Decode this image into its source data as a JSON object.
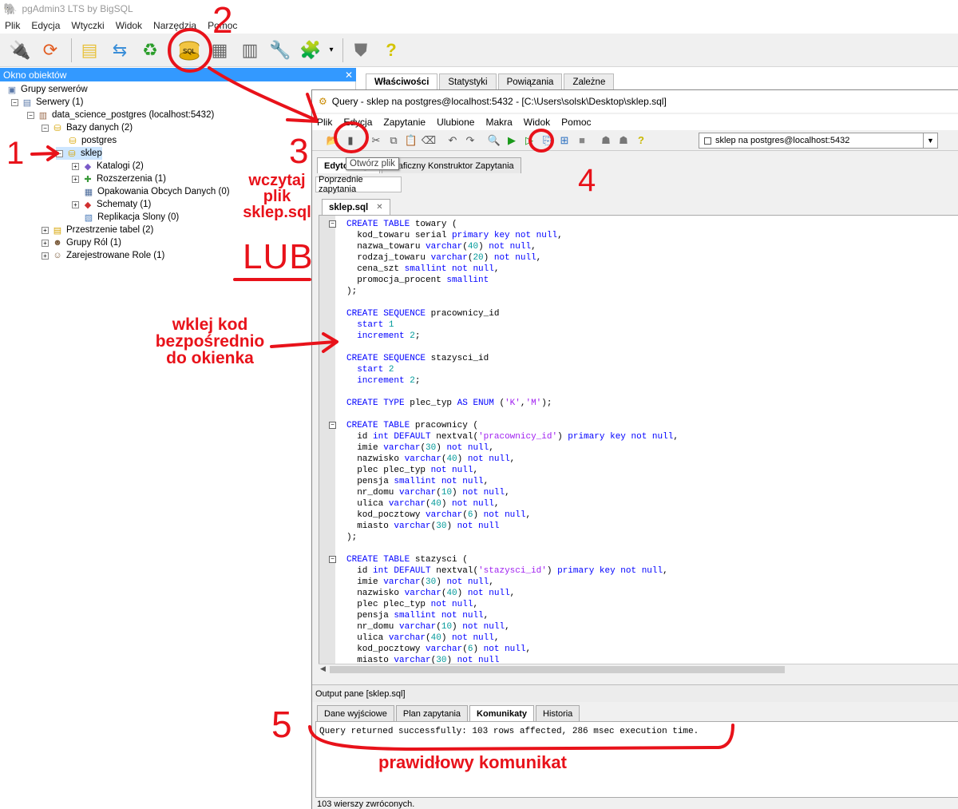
{
  "window": {
    "title": "pgAdmin3 LTS by BigSQL"
  },
  "menu": [
    "Plik",
    "Edycja",
    "Wtyczki",
    "Widok",
    "Narzędzia",
    "Pomoc"
  ],
  "toolbar": {
    "icons": [
      "plug-icon",
      "refresh-icon",
      "folders-icon",
      "transfer-icon",
      "recycle-icon",
      "sql-icon",
      "grid-icon",
      "filter-grid-icon",
      "wrench-icon",
      "plugin-icon",
      "dropdown-icon",
      "shield-icon",
      "help-icon"
    ]
  },
  "object_browser": {
    "title": "Okno obiektów",
    "close": "✕",
    "tree": [
      {
        "label": "Grupy serwerów",
        "icon": "server-group-icon",
        "level": 0,
        "toggle": ""
      },
      {
        "label": "Serwery (1)",
        "icon": "servers-icon",
        "level": 1,
        "toggle": "−"
      },
      {
        "label": "data_science_postgres (localhost:5432)",
        "icon": "server-icon",
        "level": 2,
        "toggle": "−"
      },
      {
        "label": "Bazy danych (2)",
        "icon": "databases-icon",
        "level": 3,
        "toggle": "−"
      },
      {
        "label": "postgres",
        "icon": "database-icon",
        "level": 4,
        "toggle": ""
      },
      {
        "label": "sklep",
        "icon": "database-icon",
        "level": 4,
        "toggle": "−"
      },
      {
        "label": "Katalogi (2)",
        "icon": "catalog-icon",
        "level": 5,
        "toggle": "+"
      },
      {
        "label": "Rozszerzenia (1)",
        "icon": "extension-icon",
        "level": 5,
        "toggle": "+"
      },
      {
        "label": "Opakowania Obcych Danych (0)",
        "icon": "fdw-icon",
        "level": 5,
        "toggle": ""
      },
      {
        "label": "Schematy (1)",
        "icon": "schema-icon",
        "level": 5,
        "toggle": "+"
      },
      {
        "label": "Replikacja Slony (0)",
        "icon": "slony-icon",
        "level": 5,
        "toggle": ""
      },
      {
        "label": "Przestrzenie tabel (2)",
        "icon": "tablespace-icon",
        "level": 3,
        "toggle": "+"
      },
      {
        "label": "Grupy Ról (1)",
        "icon": "group-roles-icon",
        "level": 3,
        "toggle": "+"
      },
      {
        "label": "Zarejestrowane Role (1)",
        "icon": "login-roles-icon",
        "level": 3,
        "toggle": "+"
      }
    ]
  },
  "properties_tabs": [
    "Właściwości",
    "Statystyki",
    "Powiązania",
    "Zależne"
  ],
  "query": {
    "title": "Query - sklep na postgres@localhost:5432 - [C:\\Users\\solsk\\Desktop\\sklep.sql]",
    "menu": [
      "Plik",
      "Edycja",
      "Zapytanie",
      "Ulubione",
      "Makra",
      "Widok",
      "Pomoc"
    ],
    "connection": "sklep na postgres@localhost:5432",
    "editor_tabs": [
      "Edytor SQL",
      "Graficzny Konstruktor Zapytania"
    ],
    "tooltip": "Otwórz plik",
    "previous_queries": "Poprzednie zapytania",
    "file_tab": "sklep.sql",
    "file_close": "✕",
    "output_title": "Output pane [sklep.sql]",
    "output_tabs": [
      "Dane wyjściowe",
      "Plan zapytania",
      "Komunikaty",
      "Historia"
    ],
    "message": "Query returned successfully: 103 rows affected, 286 msec execution time.",
    "status": "103 wierszy zwróconych."
  },
  "code_lines": [
    [
      [
        "CREATE TABLE",
        "kw"
      ],
      [
        " towary (",
        ""
      ]
    ],
    [
      [
        "  kod_towaru serial ",
        ""
      ],
      [
        "primary key not null",
        "kw"
      ],
      [
        ",",
        ""
      ]
    ],
    [
      [
        "  nazwa_towaru ",
        ""
      ],
      [
        "varchar",
        "kw"
      ],
      [
        "(",
        ""
      ],
      [
        "40",
        "nm"
      ],
      [
        ") ",
        ""
      ],
      [
        "not null",
        "kw"
      ],
      [
        ",",
        ""
      ]
    ],
    [
      [
        "  rodzaj_towaru ",
        ""
      ],
      [
        "varchar",
        "kw"
      ],
      [
        "(",
        ""
      ],
      [
        "20",
        "nm"
      ],
      [
        ") ",
        ""
      ],
      [
        "not null",
        "kw"
      ],
      [
        ",",
        ""
      ]
    ],
    [
      [
        "  cena_szt ",
        ""
      ],
      [
        "smallint not null",
        "kw"
      ],
      [
        ",",
        ""
      ]
    ],
    [
      [
        "  promocja_procent ",
        ""
      ],
      [
        "smallint",
        "kw"
      ]
    ],
    [
      [
        ");",
        ""
      ]
    ],
    [],
    [
      [
        "CREATE SEQUENCE",
        "kw"
      ],
      [
        " pracownicy_id",
        ""
      ]
    ],
    [
      [
        "  ",
        ""
      ],
      [
        "start",
        "kw"
      ],
      [
        " ",
        ""
      ],
      [
        "1",
        "nm"
      ]
    ],
    [
      [
        "  ",
        ""
      ],
      [
        "increment",
        "kw"
      ],
      [
        " ",
        ""
      ],
      [
        "2",
        "nm"
      ],
      [
        ";",
        ""
      ]
    ],
    [],
    [
      [
        "CREATE SEQUENCE",
        "kw"
      ],
      [
        " stazysci_id",
        ""
      ]
    ],
    [
      [
        "  ",
        ""
      ],
      [
        "start",
        "kw"
      ],
      [
        " ",
        ""
      ],
      [
        "2",
        "nm"
      ]
    ],
    [
      [
        "  ",
        ""
      ],
      [
        "increment",
        "kw"
      ],
      [
        " ",
        ""
      ],
      [
        "2",
        "nm"
      ],
      [
        ";",
        ""
      ]
    ],
    [],
    [
      [
        "CREATE TYPE",
        "kw"
      ],
      [
        " plec_typ ",
        ""
      ],
      [
        "AS ENUM",
        "kw"
      ],
      [
        " (",
        ""
      ],
      [
        "'K'",
        "st"
      ],
      [
        ",",
        ""
      ],
      [
        "'M'",
        "st"
      ],
      [
        ");",
        ""
      ]
    ],
    [],
    [
      [
        "CREATE TABLE",
        "kw"
      ],
      [
        " pracownicy (",
        ""
      ]
    ],
    [
      [
        "  id ",
        ""
      ],
      [
        "int DEFAULT",
        "kw"
      ],
      [
        " nextval(",
        ""
      ],
      [
        "'pracownicy_id'",
        "st"
      ],
      [
        ") ",
        ""
      ],
      [
        "primary key not null",
        "kw"
      ],
      [
        ",",
        ""
      ]
    ],
    [
      [
        "  imie ",
        ""
      ],
      [
        "varchar",
        "kw"
      ],
      [
        "(",
        ""
      ],
      [
        "30",
        "nm"
      ],
      [
        ") ",
        ""
      ],
      [
        "not null",
        "kw"
      ],
      [
        ",",
        ""
      ]
    ],
    [
      [
        "  nazwisko ",
        ""
      ],
      [
        "varchar",
        "kw"
      ],
      [
        "(",
        ""
      ],
      [
        "40",
        "nm"
      ],
      [
        ") ",
        ""
      ],
      [
        "not null",
        "kw"
      ],
      [
        ",",
        ""
      ]
    ],
    [
      [
        "  plec plec_typ ",
        ""
      ],
      [
        "not null",
        "kw"
      ],
      [
        ",",
        ""
      ]
    ],
    [
      [
        "  pensja ",
        ""
      ],
      [
        "smallint not null",
        "kw"
      ],
      [
        ",",
        ""
      ]
    ],
    [
      [
        "  nr_domu ",
        ""
      ],
      [
        "varchar",
        "kw"
      ],
      [
        "(",
        ""
      ],
      [
        "10",
        "nm"
      ],
      [
        ") ",
        ""
      ],
      [
        "not null",
        "kw"
      ],
      [
        ",",
        ""
      ]
    ],
    [
      [
        "  ulica ",
        ""
      ],
      [
        "varchar",
        "kw"
      ],
      [
        "(",
        ""
      ],
      [
        "40",
        "nm"
      ],
      [
        ") ",
        ""
      ],
      [
        "not null",
        "kw"
      ],
      [
        ",",
        ""
      ]
    ],
    [
      [
        "  kod_pocztowy ",
        ""
      ],
      [
        "varchar",
        "kw"
      ],
      [
        "(",
        ""
      ],
      [
        "6",
        "nm"
      ],
      [
        ") ",
        ""
      ],
      [
        "not null",
        "kw"
      ],
      [
        ",",
        ""
      ]
    ],
    [
      [
        "  miasto ",
        ""
      ],
      [
        "varchar",
        "kw"
      ],
      [
        "(",
        ""
      ],
      [
        "30",
        "nm"
      ],
      [
        ") ",
        ""
      ],
      [
        "not null",
        "kw"
      ]
    ],
    [
      [
        ");",
        ""
      ]
    ],
    [],
    [
      [
        "CREATE TABLE",
        "kw"
      ],
      [
        " stazysci (",
        ""
      ]
    ],
    [
      [
        "  id ",
        ""
      ],
      [
        "int DEFAULT",
        "kw"
      ],
      [
        " nextval(",
        ""
      ],
      [
        "'stazysci_id'",
        "st"
      ],
      [
        ") ",
        ""
      ],
      [
        "primary key not null",
        "kw"
      ],
      [
        ",",
        ""
      ]
    ],
    [
      [
        "  imie ",
        ""
      ],
      [
        "varchar",
        "kw"
      ],
      [
        "(",
        ""
      ],
      [
        "30",
        "nm"
      ],
      [
        ") ",
        ""
      ],
      [
        "not null",
        "kw"
      ],
      [
        ",",
        ""
      ]
    ],
    [
      [
        "  nazwisko ",
        ""
      ],
      [
        "varchar",
        "kw"
      ],
      [
        "(",
        ""
      ],
      [
        "40",
        "nm"
      ],
      [
        ") ",
        ""
      ],
      [
        "not null",
        "kw"
      ],
      [
        ",",
        ""
      ]
    ],
    [
      [
        "  plec plec_typ ",
        ""
      ],
      [
        "not null",
        "kw"
      ],
      [
        ",",
        ""
      ]
    ],
    [
      [
        "  pensja ",
        ""
      ],
      [
        "smallint not null",
        "kw"
      ],
      [
        ",",
        ""
      ]
    ],
    [
      [
        "  nr_domu ",
        ""
      ],
      [
        "varchar",
        "kw"
      ],
      [
        "(",
        ""
      ],
      [
        "10",
        "nm"
      ],
      [
        ") ",
        ""
      ],
      [
        "not null",
        "kw"
      ],
      [
        ",",
        ""
      ]
    ],
    [
      [
        "  ulica ",
        ""
      ],
      [
        "varchar",
        "kw"
      ],
      [
        "(",
        ""
      ],
      [
        "40",
        "nm"
      ],
      [
        ") ",
        ""
      ],
      [
        "not null",
        "kw"
      ],
      [
        ",",
        ""
      ]
    ],
    [
      [
        "  kod_pocztowy ",
        ""
      ],
      [
        "varchar",
        "kw"
      ],
      [
        "(",
        ""
      ],
      [
        "6",
        "nm"
      ],
      [
        ") ",
        ""
      ],
      [
        "not null",
        "kw"
      ],
      [
        ",",
        ""
      ]
    ],
    [
      [
        "  miasto ",
        ""
      ],
      [
        "varchar",
        "kw"
      ],
      [
        "(",
        ""
      ],
      [
        "30",
        "nm"
      ],
      [
        ") ",
        ""
      ],
      [
        "not null",
        "kw"
      ]
    ]
  ],
  "annotations": {
    "step1": "1",
    "step2": "2",
    "step3": "3",
    "step4": "4",
    "step5": "5",
    "load_file": "wczytaj plik sklep.sql",
    "or": "LUB",
    "paste_code": "wklej kod bezpośrednio do okienka",
    "correct_message": "prawidłowy komunikat",
    "color": "#e8121a"
  }
}
